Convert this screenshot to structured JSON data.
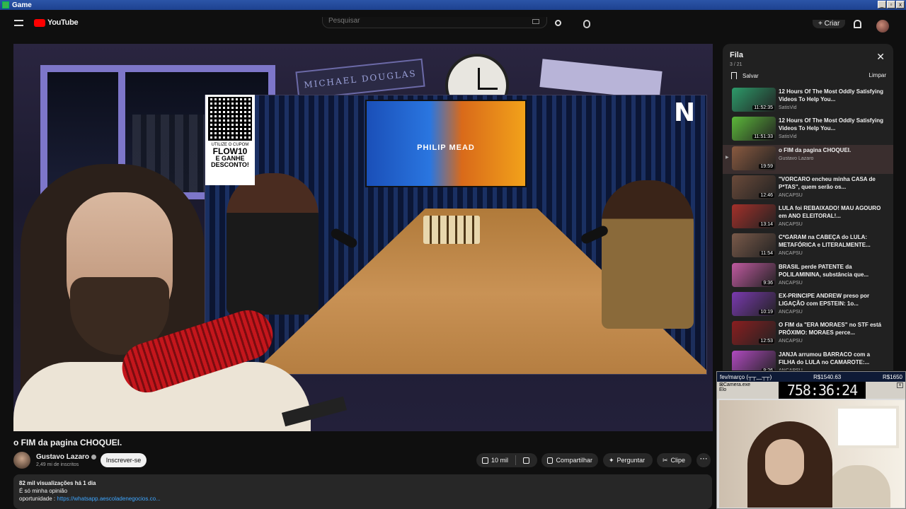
{
  "window": {
    "title": "Game"
  },
  "header": {
    "logo": "YouTube",
    "search_placeholder": "Pesquisar",
    "create_label": "Criar"
  },
  "player": {
    "sign_text": "MICHAEL DOUGLAS",
    "tv_brand": "PHILIP MEAD",
    "qr_card": {
      "line1": "UTILIZE O CUPOM",
      "line2": "FLOW10",
      "line3": "E GANHE DESCONTO!"
    }
  },
  "video": {
    "title": "o FIM da pagina CHOQUEI.",
    "channel": "Gustavo Lazaro",
    "subscribers": "2,49 mi de inscritos",
    "subscribe_label": "Inscrever-se",
    "likes": "10 mil",
    "share_label": "Compartilhar",
    "ask_label": "Perguntar",
    "clip_label": "Clipe",
    "more_label": "⋯",
    "description": {
      "stats": "82 mil visualizações  há 1 dia",
      "line1": "É só minha opinião",
      "line2_prefix": "oportunidade : ",
      "line2_link": "https://whatsapp.aescoladenegocios.co..."
    }
  },
  "queue": {
    "title": "Fila",
    "count": "3 / 21",
    "save_label": "Salvar",
    "clear_label": "Limpar",
    "items": [
      {
        "title": "12 Hours Of The Most Oddly Satisfying Videos To Help You...",
        "channel": "SatisVid",
        "duration": "11:52:35",
        "current": false,
        "thumb": "#2d9b6a"
      },
      {
        "title": "12 Hours Of The Most Oddly Satisfying Videos To Help You...",
        "channel": "SatisVid",
        "duration": "11:51:33",
        "current": false,
        "thumb": "#5cb83a"
      },
      {
        "title": "o FIM da pagina CHOQUEI.",
        "channel": "Gustavo Lazaro",
        "duration": "19:59",
        "current": true,
        "thumb": "#8a5a40"
      },
      {
        "title": "\"VORCARO encheu minha CASA de P*TAS\", quem serão os...",
        "channel": "ANCAPSU",
        "duration": "12:46",
        "current": false,
        "thumb": "#6a4a3a"
      },
      {
        "title": "LULA foi REBAIXADO! MAU AGOURO em ANO ELEITORAL!...",
        "channel": "ANCAPSU",
        "duration": "13:14",
        "current": false,
        "thumb": "#a3302a"
      },
      {
        "title": "C*GARAM na CABEÇA do LULA: METAFÓRICA e LITERALMENTE...",
        "channel": "ANCAPSU",
        "duration": "11:54",
        "current": false,
        "thumb": "#7a5a4a"
      },
      {
        "title": "BRASIL perde PATENTE da POLILAMININA, substância que...",
        "channel": "ANCAPSU",
        "duration": "9:36",
        "current": false,
        "thumb": "#c05aa0"
      },
      {
        "title": "EX-PRINCIPE ANDREW preso por LIGAÇÃO com EPSTEIN: 1o...",
        "channel": "ANCAPSU",
        "duration": "10:19",
        "current": false,
        "thumb": "#7a3ab0"
      },
      {
        "title": "O FIM da \"ERA MORAES\" no STF está PRÓXIMO: MORAES perce...",
        "channel": "ANCAPSU",
        "duration": "12:53",
        "current": false,
        "thumb": "#8a1e20"
      },
      {
        "title": "JANJA arrumou BARRACO com a FILHA do LULA no CAMAROTE:...",
        "channel": "ANCAPSU",
        "duration": "9:26",
        "current": false,
        "thumb": "#b04ac0"
      }
    ]
  },
  "overlay": {
    "top_left": "fev/março (┬┬﹏┬┬)",
    "top_mid": "R$1540.63",
    "top_right": "R$1650",
    "app_label": "⊠Camera.exe",
    "sub_label": "Elo",
    "timer": "758:36:24"
  }
}
